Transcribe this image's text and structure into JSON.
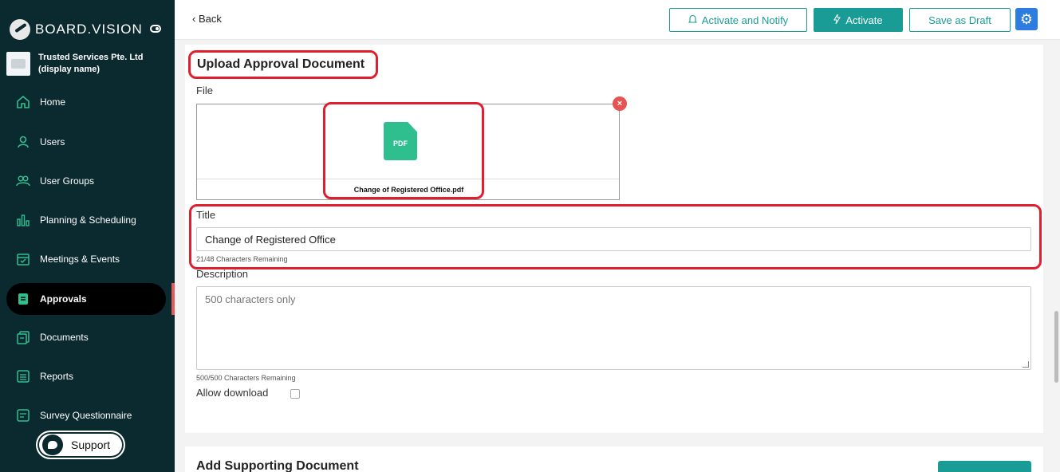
{
  "brand": {
    "logo_text": "BOARD.VISION"
  },
  "org": {
    "line1": "Trusted Services Pte. Ltd",
    "line2": "(display name)"
  },
  "sidebar": {
    "items": [
      {
        "label": "Home",
        "icon": "home-icon"
      },
      {
        "label": "Users",
        "icon": "user-icon"
      },
      {
        "label": "User Groups",
        "icon": "user-group-icon"
      },
      {
        "label": "Planning & Scheduling",
        "icon": "bar-chart-icon"
      },
      {
        "label": "Meetings & Events",
        "icon": "calendar-icon"
      },
      {
        "label": "Approvals",
        "icon": "approval-doc-icon",
        "active": true
      },
      {
        "label": "Documents",
        "icon": "documents-icon"
      },
      {
        "label": "Reports",
        "icon": "report-icon"
      },
      {
        "label": "Survey Questionnaire",
        "icon": "survey-icon"
      }
    ],
    "support_label": "Support"
  },
  "header": {
    "back_label": "Back",
    "activate_notify_label": "Activate and Notify",
    "activate_label": "Activate",
    "save_draft_label": "Save as Draft"
  },
  "form": {
    "section_title": "Upload Approval Document",
    "file_label": "File",
    "file_type_label": "PDF",
    "file_name": "Change of Registered Office.pdf",
    "title_label": "Title",
    "title_value": "Change of Registered Office",
    "title_hint": "21/48 Characters Remaining",
    "description_label": "Description",
    "description_placeholder": "500 characters only",
    "description_hint": "500/500 Characters Remaining",
    "allow_download_label": "Allow download",
    "allow_download_checked": false
  },
  "next_section": {
    "title": "Add Supporting Document"
  },
  "colors": {
    "sidebar_bg": "#0b2a30",
    "accent": "#1a9c96",
    "annotation": "#e01e2e",
    "settings": "#2d7de0"
  }
}
